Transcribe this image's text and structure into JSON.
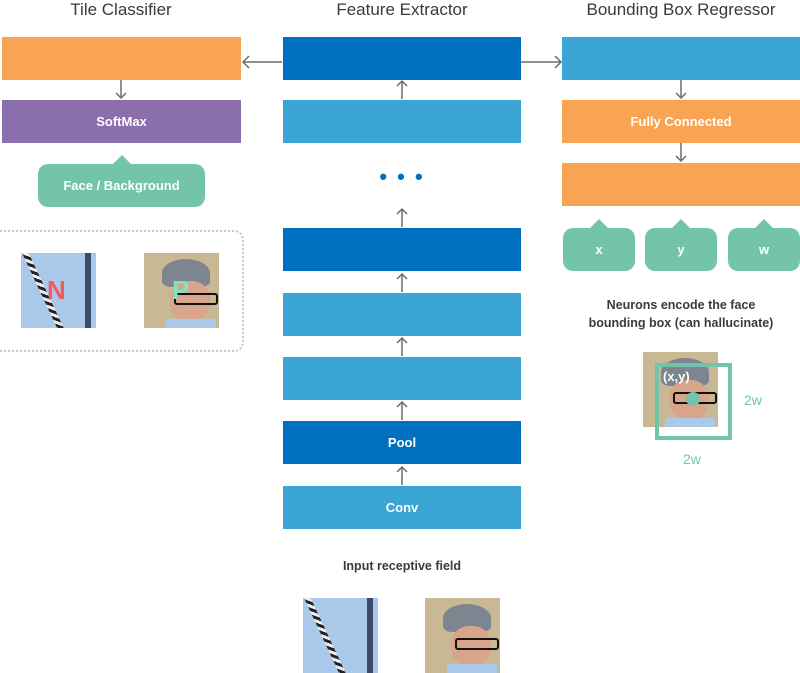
{
  "sections": {
    "tile_classifier": {
      "title": "Tile Classifier",
      "softmax_label": "SoftMax",
      "output_label": "Face / Background",
      "examples": [
        {
          "label": "N",
          "kind": "negative",
          "color": "#f25c5c"
        },
        {
          "label": "P",
          "kind": "positive",
          "color": "#7fe3c4"
        }
      ]
    },
    "feature_extractor": {
      "title": "Feature Extractor",
      "layers": [
        "",
        "",
        "",
        "",
        "",
        "Pool",
        "Conv"
      ],
      "ellipsis": "• • •",
      "input_caption": "Input receptive field"
    },
    "bbox_regressor": {
      "title": "Bounding Box Regressor",
      "fc_label": "Fully Connected",
      "outputs": [
        "x",
        "y",
        "w"
      ],
      "caption_line1": "Neurons encode the face",
      "caption_line2": "bounding box (can hallucinate)",
      "point_label": "(x,y)",
      "width_label": "2w",
      "height_label": "2w"
    }
  },
  "colors": {
    "orange": "#f9a452",
    "purple": "#8b6fad",
    "dark_blue": "#0071c1",
    "light_blue": "#3ba6d4",
    "teal": "#74c4ab"
  }
}
